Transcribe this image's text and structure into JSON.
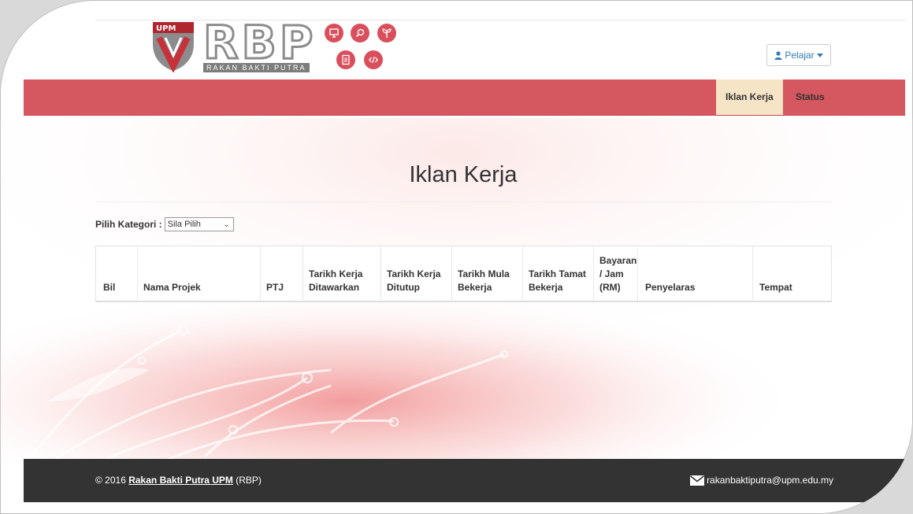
{
  "header": {
    "brand": {
      "letters": [
        "R",
        "B",
        "P"
      ],
      "subtitle": "RAKAN BAKTI PUTRA",
      "shield_text": "UPM",
      "icons": [
        "monitor-icon",
        "search-icon",
        "sprout-icon",
        "document-icon",
        "code-icon"
      ]
    },
    "user_menu": {
      "label": "Pelajar",
      "icon": "user-icon",
      "caret": "chevron-down-icon"
    }
  },
  "nav": {
    "items": [
      {
        "label": "Iklan Kerja",
        "active": true
      },
      {
        "label": "Status",
        "active": false
      }
    ],
    "color": "#d5575f",
    "active_color": "#f6e4c7"
  },
  "main": {
    "title": "Iklan Kerja",
    "filter": {
      "label": "Pilih Kategori :",
      "selected": "Sila Pilih"
    },
    "table": {
      "columns": [
        "Bil",
        "Nama Projek",
        "PTJ",
        "Tarikh Kerja\nDitawarkan",
        "Tarikh Kerja\nDitutup",
        "Tarikh Mula\nBekerja",
        "Tarikh Tamat\nBekerja",
        "Bayaran\n/ Jam\n(RM)",
        "Penyelaras",
        "Tempat"
      ],
      "rows": []
    }
  },
  "footer": {
    "copyright_prefix": "© 2016",
    "org_link": "Rakan Bakti Putra UPM",
    "org_suffix": "(RBP)",
    "email": "rakanbaktiputra@upm.edu.my",
    "email_icon": "envelope-icon"
  }
}
